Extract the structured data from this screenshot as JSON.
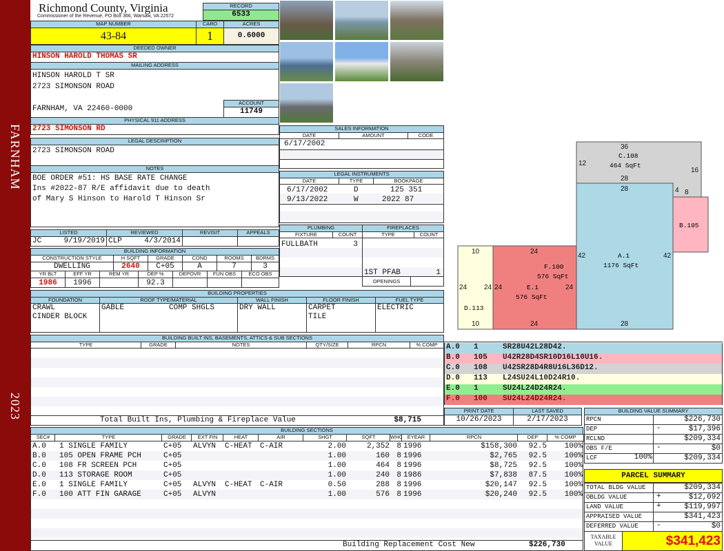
{
  "sidebar": {
    "town": "FARNHAM",
    "year": "2023"
  },
  "header": {
    "county": "Richmond County, Virginia",
    "commissioner": "Commissioner of the Revenue, PO Box 366, Warsaw, VA 22572",
    "record_label": "RECORD",
    "record": "6533",
    "map_label": "MAP NUMBER",
    "map": "43-84",
    "card_label": "CARD",
    "card": "1",
    "acres_label": "ACRES",
    "acres": "0.6000"
  },
  "owner": {
    "label": "DEEDED OWNER",
    "name": "HINSON HAROLD THOMAS SR",
    "mailing_label": "MAILING ADDRESS",
    "mail": [
      "HINSON HAROLD T SR",
      "2723 SIMONSON ROAD",
      "",
      "FARNHAM, VA 22460-0000"
    ],
    "account_label": "ACCOUNT",
    "account": "11749",
    "physical_label": "PHYSICAL 911 ADDRESS",
    "physical": "2723 SIMONSON RD"
  },
  "legal": {
    "label": "LEGAL DESCRIPTION",
    "text": "2723 SIMONSON ROAD"
  },
  "notes": {
    "label": "NOTES",
    "lines": [
      "BOE ORDER #51: HS BASE RATE CHANGE",
      "Ins #2022-87 R/E affidavit due to death",
      "of Mary S Hinson to Harold T Hinson Sr"
    ]
  },
  "listing": {
    "listed_label": "LISTED",
    "listed_by": "JC",
    "listed": "9/19/2019",
    "reviewed_label": "REVIEWED",
    "reviewed_by": "CLP",
    "reviewed": "4/3/2014",
    "revisit_label": "REVISIT",
    "appeals_label": "APPEALS"
  },
  "building_info": {
    "label": "BUILDING INFORMATION",
    "cols1": [
      "CONSTRUCTION STYLE",
      "H SQFT",
      "GRADE",
      "COND",
      "ROOMS",
      "BDRMS"
    ],
    "vals1": [
      "DWELLING",
      "2640",
      "C+05",
      "A",
      "7",
      "3"
    ],
    "cols2": [
      "YR BLT",
      "EFF YR",
      "REM YR",
      "DEP %",
      "DEPOVR",
      "FUN OBS",
      "ECO OBS"
    ],
    "vals2": [
      "1986",
      "1996",
      "",
      "92.3",
      "",
      "",
      ""
    ]
  },
  "properties": {
    "label": "BUILDING PROPERTIES",
    "cols": [
      "FOUNDATION",
      "ROOF TYPE/MATERIAL",
      "WALL FINISH",
      "FLOOR FINISH",
      "FUEL TYPE"
    ],
    "foundation": [
      "CRAWL",
      "CINDER BLOCK"
    ],
    "roof_type": "GABLE",
    "roof_material": "COMP SHGLS",
    "wall": "DRY WALL",
    "floor": [
      "CARPET",
      "TILE"
    ],
    "fuel": "ELECTRIC"
  },
  "builtins": {
    "label": "BUILDING BUILT INS, BASEMENTS, ATTICS & SUB SECTIONS",
    "cols": [
      "TYPE",
      "GRADE",
      "NOTES",
      "QTY/SIZE",
      "RPCN",
      "% COMP"
    ],
    "total_label": "Total Built Ins, Plumbing & Fireplace Value",
    "total": "$8,715"
  },
  "sales": {
    "label": "SALES INFORMATION",
    "cols": [
      "DATE",
      "AMOUNT",
      "CODE"
    ],
    "rows": [
      [
        "6/17/2002",
        "",
        ""
      ]
    ]
  },
  "instruments": {
    "label": "LEGAL INSTRUMENTS",
    "cols": [
      "DATE",
      "TYPE",
      "BOOKPAGE"
    ],
    "rows": [
      [
        "6/17/2002",
        "D",
        "125 351"
      ],
      [
        "9/13/2022",
        "W",
        "2022 87"
      ]
    ]
  },
  "plumbing": {
    "label": "PLUMBING",
    "cols": [
      "FIXTURE",
      "COUNT"
    ],
    "rows": [
      [
        "FULLBATH",
        "3"
      ]
    ]
  },
  "fireplaces": {
    "label": "FIREPLACES",
    "cols": [
      "TYPE",
      "COUNT"
    ],
    "rows": [
      [
        "1ST PFAB",
        "1"
      ]
    ],
    "openings_label": "OPENINGS"
  },
  "sketch": {
    "labels": {
      "c": "C.108",
      "c_area": "464 SqFt",
      "a": "A.1",
      "a_area": "1176 SqFt",
      "b": "B.105",
      "f": "F.100",
      "f_area": "576 SqFt",
      "e": "E.1",
      "e_area": "576 SqFt",
      "d": "D.113"
    },
    "dims": {
      "c_top": "36",
      "c_left": "12",
      "c_right": "16",
      "c_bottom": "28",
      "a_top": "28",
      "a_left": "42",
      "a_right": "42",
      "a_bottom": "28",
      "b_top1": "4",
      "b_top2": "8",
      "f_top": "24",
      "f_bottom": "24",
      "f_left": "24",
      "f_right": "24",
      "d_top": "10",
      "d_bottom": "10",
      "d_left": "24",
      "d_right": "24"
    }
  },
  "codes": [
    {
      "sec": "A.0",
      "code": "1",
      "path": "SR28U42L28D42.",
      "color": "#add8e6"
    },
    {
      "sec": "B.0",
      "code": "105",
      "path": "U42R28D4SR10D16L10U16.",
      "color": "#ffb6c1"
    },
    {
      "sec": "C.0",
      "code": "108",
      "path": "U42SR28D4R8U16L36D12.",
      "color": "#d3d3d3"
    },
    {
      "sec": "D.0",
      "code": "113",
      "path": "L24SU24L10D24R10.",
      "color": "#ffffe0"
    },
    {
      "sec": "E.0",
      "code": "1",
      "path": "SU24L24D24R24.",
      "color": "#90ee90"
    },
    {
      "sec": "F.0",
      "code": "100",
      "path": "SU24L24D24R24.",
      "color": "#f08080"
    }
  ],
  "dates": {
    "print_label": "PRINT DATE",
    "print": "10/26/2023",
    "saved_label": "LAST SAVED",
    "saved": "2/17/2023"
  },
  "sections": {
    "label": "BUILDING SECTIONS",
    "cols": [
      "SEC#",
      "TYPE",
      "GRADE",
      "EXT FIN",
      "HEAT",
      "AIR",
      "SHGT",
      "SQFT",
      "WHGT",
      "EYEAR",
      "RPCN",
      "DEP",
      "% COMP"
    ],
    "rows": [
      [
        "A.0",
        "1 SINGLE FAMILY",
        "C+05",
        "ALVYN",
        "C-HEAT",
        "C-AIR",
        "2.00",
        "2,352",
        "8",
        "1996",
        "$158,300",
        "92.5",
        "100%"
      ],
      [
        "B.0",
        "105 OPEN FRAME PCH",
        "C+05",
        "",
        "",
        "",
        "1.00",
        "160",
        "8",
        "1996",
        "$2,765",
        "92.5",
        "100%"
      ],
      [
        "C.0",
        "108 FR SCREEN PCH",
        "C+05",
        "",
        "",
        "",
        "1.00",
        "464",
        "8",
        "1996",
        "$8,725",
        "92.5",
        "100%"
      ],
      [
        "D.0",
        "113 STORAGE ROOM",
        "C+05",
        "",
        "",
        "",
        "1.00",
        "240",
        "8",
        "1986",
        "$7,838",
        "87.5",
        "100%"
      ],
      [
        "E.0",
        "1 SINGLE FAMILY",
        "C+05",
        "ALVYN",
        "C-HEAT",
        "C-AIR",
        "0.50",
        "288",
        "8",
        "1996",
        "$20,147",
        "92.5",
        "100%"
      ],
      [
        "F.0",
        "100 ATT FIN GARAGE",
        "C+05",
        "ALVYN",
        "",
        "",
        "1.00",
        "576",
        "8",
        "1996",
        "$20,240",
        "92.5",
        "100%"
      ]
    ],
    "total_label": "Building Replacement Cost New",
    "total": "$226,730"
  },
  "value_summary": {
    "label": "BUILDING VALUE SUMMARY",
    "rows": [
      [
        "RPCN",
        "",
        "$226,730"
      ],
      [
        "DEP",
        "-",
        "$17,396"
      ],
      [
        "RCLND",
        "",
        "$209,334"
      ],
      [
        "OBS F/E",
        "-",
        "$0"
      ],
      [
        "LCF",
        "100%",
        "$209,334"
      ]
    ]
  },
  "parcel": {
    "label": "PARCEL SUMMARY",
    "rows": [
      [
        "TOTAL BLDG VALUE",
        "",
        "$209,334"
      ],
      [
        "OBLDG VALUE",
        "+",
        "$12,092"
      ],
      [
        "LAND VALUE",
        "+",
        "$119,997"
      ],
      [
        "APPRAISED VALUE",
        "",
        "$341,423"
      ],
      [
        "DEFERRED VALUE",
        "-",
        "$0"
      ]
    ],
    "taxable_label": "TAXABLE VALUE",
    "taxable": "$341,423"
  }
}
